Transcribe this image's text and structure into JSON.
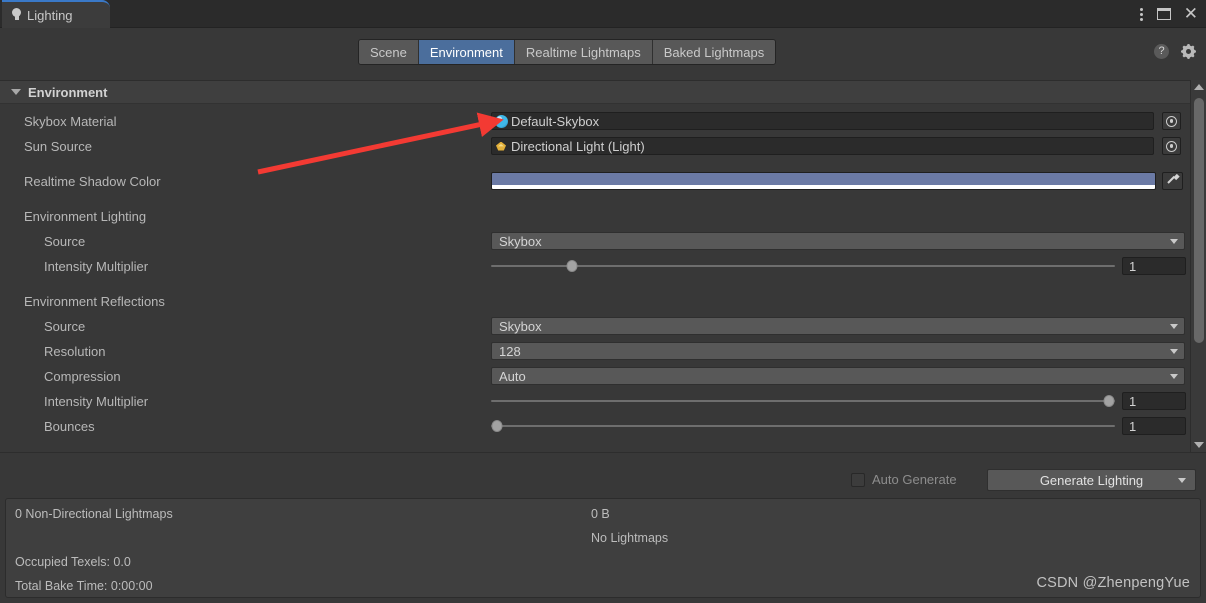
{
  "window": {
    "tab_title": "Lighting",
    "tab_icon": "lightbulb-icon",
    "controls": {
      "menu": "kebab-menu-icon",
      "maximize": "maximize-icon",
      "close": "close-icon"
    }
  },
  "toolbar": {
    "tabs": [
      {
        "label": "Scene",
        "selected": false
      },
      {
        "label": "Environment",
        "selected": true
      },
      {
        "label": "Realtime Lightmaps",
        "selected": false
      },
      {
        "label": "Baked Lightmaps",
        "selected": false
      }
    ],
    "help_icon": "help-icon",
    "gear_icon": "gear-icon"
  },
  "foldout": {
    "title": "Environment",
    "expanded": true
  },
  "fields": {
    "skybox_material": {
      "label": "Skybox Material",
      "value": "Default-Skybox",
      "icon": "material-sphere-icon",
      "picker": "object-picker-icon"
    },
    "sun_source": {
      "label": "Sun Source",
      "value": "Directional Light (Light)",
      "icon": "directional-light-icon",
      "picker": "object-picker-icon"
    },
    "realtime_shadow_color": {
      "label": "Realtime Shadow Color",
      "color": "#6b7aa5",
      "alpha_color": "#ffffff",
      "eyedropper": "eyedropper-icon"
    }
  },
  "environment_lighting": {
    "group_label": "Environment Lighting",
    "source": {
      "label": "Source",
      "value": "Skybox"
    },
    "intensity_multiplier": {
      "label": "Intensity Multiplier",
      "value": "1",
      "slider_percent": 13
    }
  },
  "environment_reflections": {
    "group_label": "Environment Reflections",
    "source": {
      "label": "Source",
      "value": "Skybox"
    },
    "resolution": {
      "label": "Resolution",
      "value": "128"
    },
    "compression": {
      "label": "Compression",
      "value": "Auto"
    },
    "intensity_multiplier": {
      "label": "Intensity Multiplier",
      "value": "1",
      "slider_percent": 99
    },
    "bounces": {
      "label": "Bounces",
      "value": "1",
      "slider_percent": 1
    }
  },
  "bottom": {
    "auto_generate_label": "Auto Generate",
    "auto_generate_checked": false,
    "generate_lighting_label": "Generate Lighting"
  },
  "status": {
    "lightmaps_count": "0 Non-Directional Lightmaps",
    "size": "0 B",
    "no_lightmaps": "No Lightmaps",
    "occupied_texels": "Occupied Texels: 0.0",
    "total_bake_time": "Total Bake Time: 0:00:00"
  },
  "watermark": "CSDN @ZhenpengYue",
  "annotation": {
    "type": "red-arrow",
    "color": "#f33a33"
  }
}
